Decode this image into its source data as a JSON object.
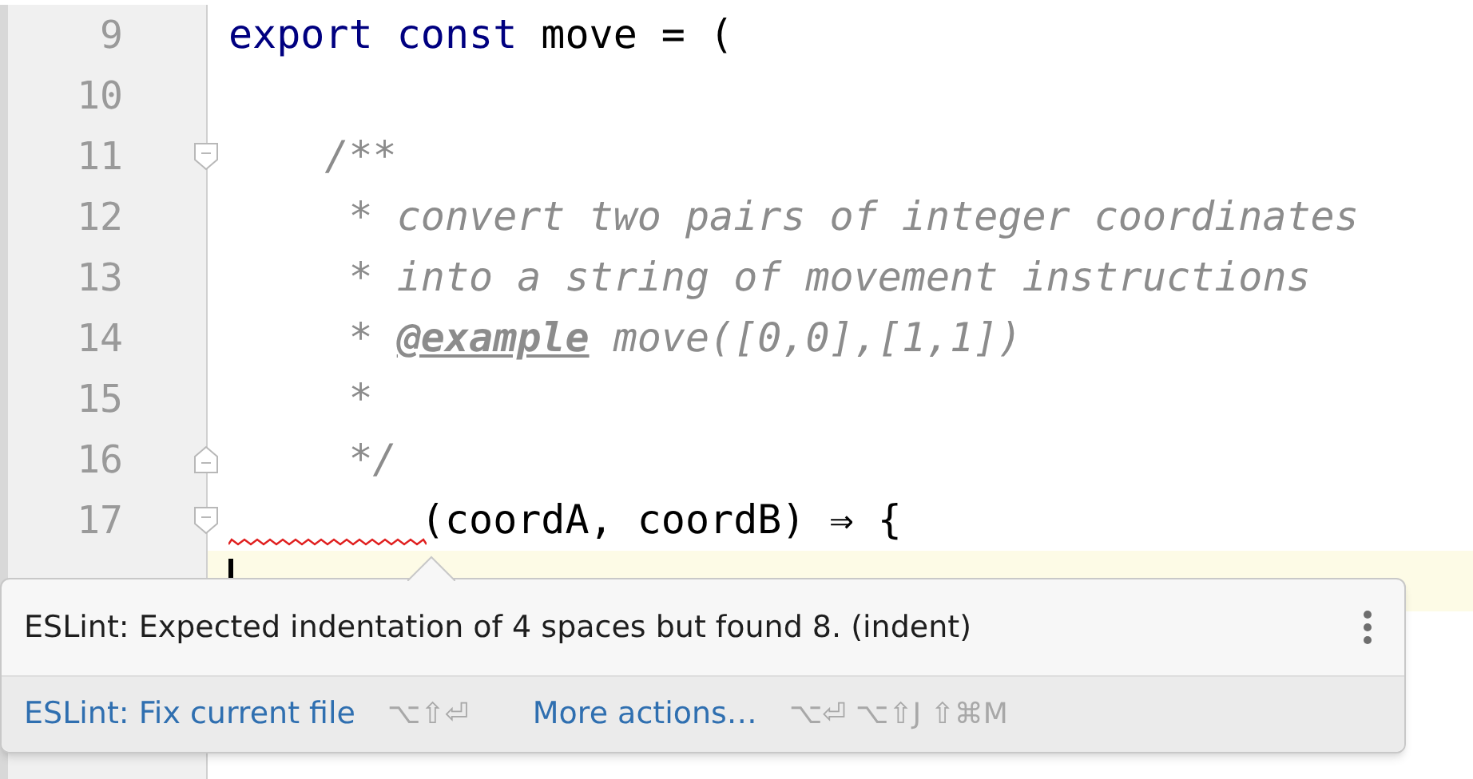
{
  "editor": {
    "lines": [
      {
        "number": "9",
        "kind": "plain",
        "segments": [
          {
            "text": "export const",
            "kind": "keyword"
          },
          {
            "text": " move = (",
            "kind": "plain"
          }
        ]
      },
      {
        "number": "10",
        "kind": "plain"
      },
      {
        "number": "11",
        "kind": "foldstart",
        "segments": [
          {
            "text": "    /**",
            "kind": "doc"
          }
        ]
      },
      {
        "number": "12",
        "kind": "plain",
        "segments": [
          {
            "text": "     * convert two pairs of integer coordinates",
            "kind": "doc"
          }
        ]
      },
      {
        "number": "13",
        "kind": "plain",
        "segments": [
          {
            "text": "     * into a string of movement instructions",
            "kind": "doc"
          }
        ]
      },
      {
        "number": "14",
        "kind": "plain",
        "segments": [
          {
            "text": "     * ",
            "kind": "doc"
          },
          {
            "text": "@example",
            "kind": "doctag"
          },
          {
            "text": " move([0,0],[1,1])",
            "kind": "doc"
          }
        ]
      },
      {
        "number": "15",
        "kind": "plain",
        "segments": [
          {
            "text": "     *",
            "kind": "doc"
          }
        ]
      },
      {
        "number": "16",
        "kind": "foldend",
        "segments": [
          {
            "text": "     */",
            "kind": "doc"
          }
        ]
      },
      {
        "number": "17",
        "kind": "foldstart",
        "error": true,
        "segments": [
          {
            "text": "        (coordA, coordB) ⇒ {",
            "kind": "plain"
          }
        ]
      }
    ],
    "current_line_caret": true
  },
  "popup": {
    "message": "ESLint: Expected indentation of 4 spaces but found 8. (indent)",
    "actions": [
      {
        "label": "ESLint: Fix current file",
        "shortcut": "⌥⇧⏎"
      },
      {
        "label": "More actions…",
        "shortcut": "⌥⏎ ⌥⇧J ⇧⌘M"
      }
    ]
  }
}
